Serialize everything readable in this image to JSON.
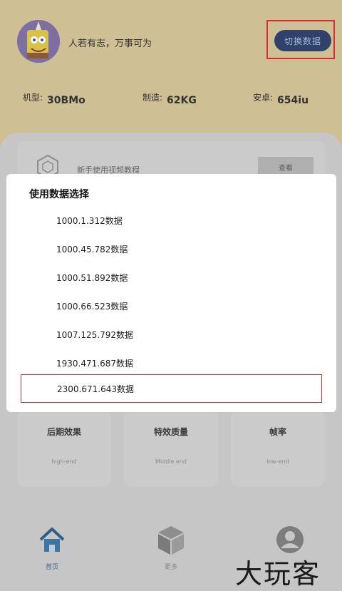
{
  "header": {
    "motto": "人若有志，万事可为",
    "switch_button": "切换数据"
  },
  "stats": [
    {
      "label": "机型:",
      "value": "30BMo"
    },
    {
      "label": "制造:",
      "value": "62KG"
    },
    {
      "label": "安卓:",
      "value": "654iu"
    }
  ],
  "tutorial": {
    "text": "新手使用视频教程",
    "view_button": "查看"
  },
  "cards": [
    {
      "title": "后期效果",
      "subtitle": "high-end"
    },
    {
      "title": "特效质量",
      "subtitle": "Middle end"
    },
    {
      "title": "帧率",
      "subtitle": "low-end"
    }
  ],
  "nav": [
    {
      "label": "首页"
    },
    {
      "label": "更多"
    },
    {
      "label": ""
    }
  ],
  "dialog": {
    "title": "使用数据选择",
    "options": [
      "1000.1.312数据",
      "1000.45.782数据",
      "1000.51.892数据",
      "1000.66.523数据",
      "1007.125.792数据",
      "1930.471.687数据",
      "2300.671.643数据"
    ]
  },
  "watermark": "大玩客"
}
